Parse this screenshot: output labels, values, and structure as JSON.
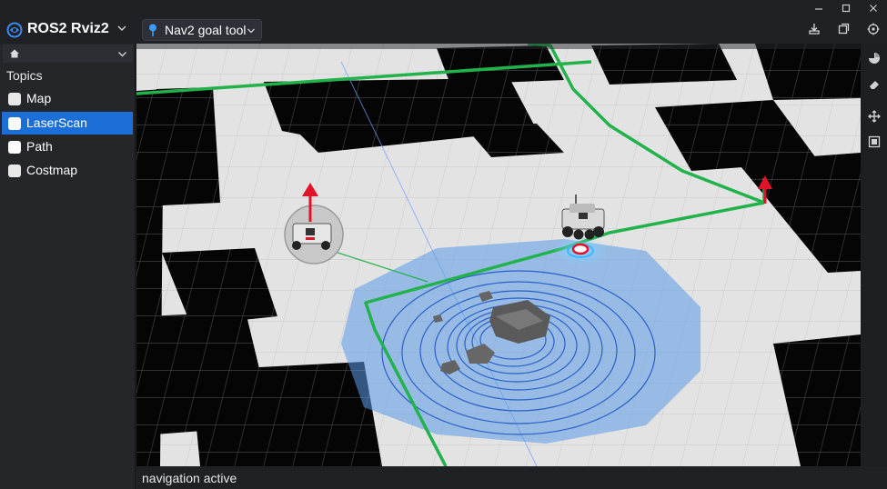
{
  "app": {
    "title": "ROS2 Rviz2",
    "icon": "ros-logo-icon"
  },
  "window_controls": [
    "minimize-icon",
    "maximize-icon",
    "close-icon"
  ],
  "toolbar": {
    "tool_label": "Nav2 goal tool",
    "tool_icon": "map-pin-icon",
    "right_icons": [
      "robot-download-icon",
      "window-copy-icon",
      "target-icon"
    ]
  },
  "left_panel": {
    "nav_icon": "home-icon",
    "section_title": "Topics",
    "topics": [
      {
        "label": "Map",
        "checked": false,
        "selected": false
      },
      {
        "label": "LaserScan",
        "checked": false,
        "selected": true
      },
      {
        "label": "Path",
        "checked": false,
        "selected": false
      },
      {
        "label": "Costmap",
        "checked": false,
        "selected": false
      }
    ]
  },
  "right_toolbar": [
    "pie-chart-icon",
    "eraser-icon",
    "move-icon",
    "panel-icon"
  ],
  "status": {
    "text": "navigation active"
  },
  "colors": {
    "accent": "#1b6fd6",
    "path": "#22b24c",
    "costmap": "#5a9be6",
    "goal_arrow": "#e0132a"
  }
}
